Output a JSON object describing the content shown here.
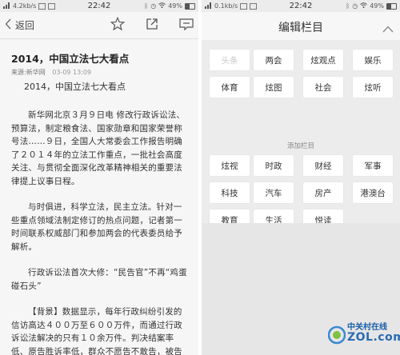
{
  "left": {
    "status": {
      "speed": "4.2kb/s",
      "time": "22:42",
      "battery": "49%"
    },
    "toolbar": {
      "back_label": "返回"
    },
    "article": {
      "title": "2014，中国立法七大看点",
      "source": "来源:新华网",
      "datetime": "03-09 13:09",
      "subtitle": "2014，中国立法七大看点",
      "paragraphs": [
        "新华网北京３月９日电 修改行政诉讼法、预算法，制定粮食法、国家勋章和国家荣誉称号法……９日，全国人大常委会工作报告明确了２０１４年的立法工作重点，一批社会高度关注、与贯彻全面深化改革精神相关的重要法律提上议事日程。",
        "与时俱进，科学立法，民主立法。针对一些重点领域法制定修订的热点问题，记者第一时间联系权威部门和参加两会的代表委员给予解析。",
        "行政诉讼法首次大修：“民告官”不再“鸡蛋碰石头”",
        "【背景】数据显示，每年行政纠纷引发的信访高达４００万至６００万件，而通过行政诉讼法解决的只有１０余万件。判决结案率低、原告胜诉率低，群众不愿告不敢告，被告席时常了…法院不受理"
      ]
    }
  },
  "right": {
    "status": {
      "speed": "0.1kb/s",
      "time": "22:42",
      "battery": "49%"
    },
    "header": {
      "title": "编辑栏目"
    },
    "my_tags": [
      {
        "label": "头条",
        "disabled": true
      },
      {
        "label": "两会",
        "disabled": false
      },
      {
        "label": "炫观点",
        "disabled": false
      },
      {
        "label": "娱乐",
        "disabled": false
      },
      {
        "label": "体育",
        "disabled": false
      },
      {
        "label": "炫图",
        "disabled": false
      },
      {
        "label": "社会",
        "disabled": false
      },
      {
        "label": "炫听",
        "disabled": false
      }
    ],
    "add_label": "添加栏目",
    "add_tags": [
      {
        "label": "炫视"
      },
      {
        "label": "时政"
      },
      {
        "label": "财经"
      },
      {
        "label": "军事"
      },
      {
        "label": "科技"
      },
      {
        "label": "汽车"
      },
      {
        "label": "房产"
      },
      {
        "label": "港澳台"
      },
      {
        "label": "教育"
      },
      {
        "label": "生活"
      },
      {
        "label": "悦读"
      }
    ]
  },
  "watermark": {
    "line1": "中关村在线",
    "line2": "ZOL.com.cn"
  }
}
